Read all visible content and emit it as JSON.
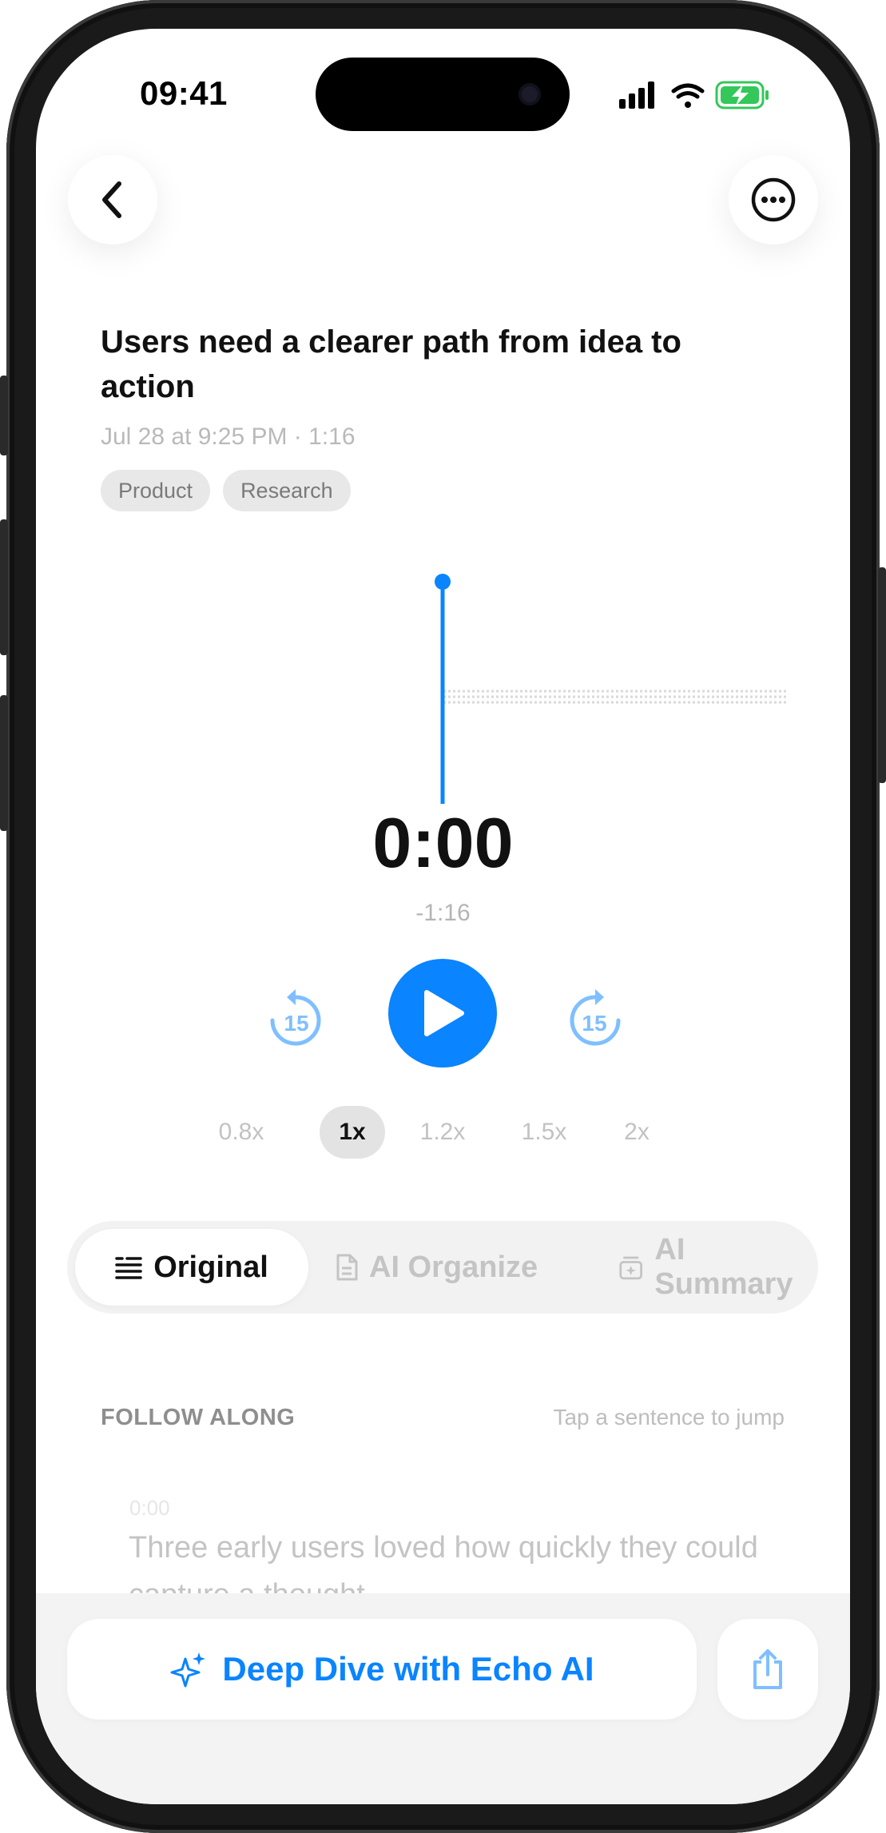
{
  "status_bar": {
    "time": "09:41"
  },
  "recording": {
    "title": "Users need a clearer path from idea to action",
    "meta": "Jul 28 at 9:25 PM · 1:16",
    "tags": [
      "Product",
      "Research"
    ]
  },
  "player": {
    "elapsed": "0:00",
    "remaining": "-1:16",
    "progress": 0,
    "skip_back_seconds": "15",
    "skip_forward_seconds": "15",
    "speeds": [
      "0.8x",
      "1x",
      "1.2x",
      "1.5x",
      "2x"
    ],
    "selected_speed": "1x"
  },
  "view_tabs": {
    "items": [
      "Original",
      "AI Organize",
      "AI Summary"
    ],
    "selected": "Original"
  },
  "transcript": {
    "section_label": "FOLLOW ALONG",
    "hint": "Tap a sentence to jump",
    "segments": [
      {
        "time": "0:00",
        "text": "Three early users loved how quickly they could capture a thought."
      }
    ]
  },
  "actions": {
    "deep_dive_label": "Deep Dive with Echo AI"
  },
  "colors": {
    "accent": "#0a84ff",
    "battery": "#34c759"
  }
}
